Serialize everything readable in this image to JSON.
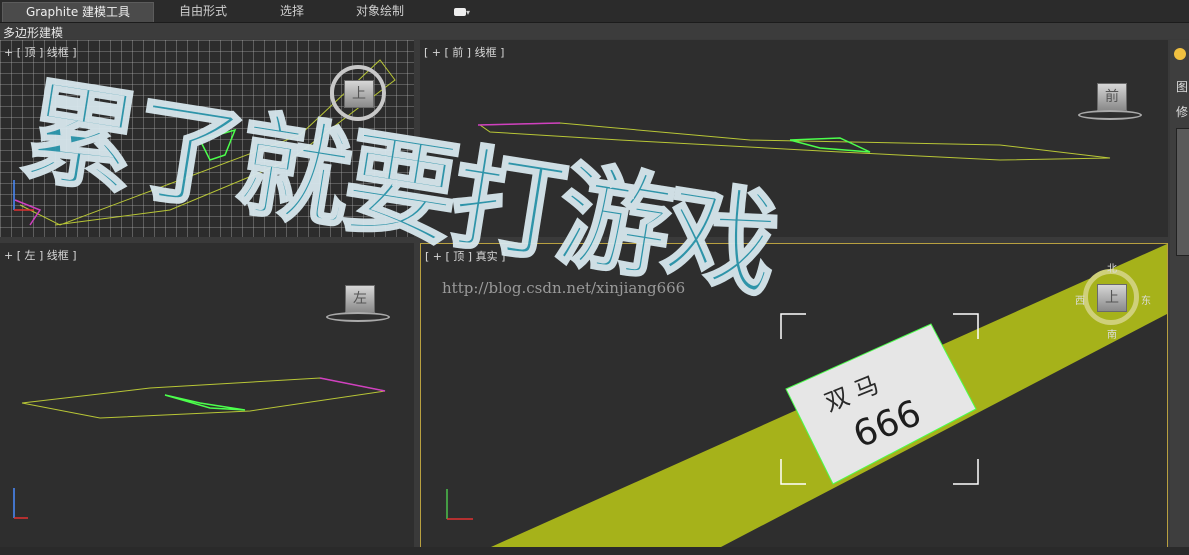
{
  "ribbon": {
    "tabs": [
      {
        "label": "Graphite 建模工具",
        "active": true
      },
      {
        "label": "自由形式"
      },
      {
        "label": "选择"
      },
      {
        "label": "对象绘制"
      }
    ]
  },
  "subbar": {
    "label": "多边形建模"
  },
  "viewports": {
    "top": {
      "label": "+ [ 顶 ] 线框 ]",
      "cube": "上"
    },
    "front": {
      "label": "[ + [ 前 ] 线框 ]",
      "cube": "前"
    },
    "left": {
      "label": "+ [ 左 ] 线框 ]",
      "cube": "左"
    },
    "persp": {
      "label": "[ + [ 顶 ] 真实 ]",
      "cube": "上"
    }
  },
  "compass": {
    "north": "北",
    "south": "南",
    "east": "东",
    "west": "西"
  },
  "plate_text": {
    "line1": "双 马",
    "line2": "666"
  },
  "watermark": {
    "text": "累了就要打游戏",
    "url": "http://blog.csdn.net/xinjiang666"
  },
  "side_panel": {
    "labels": [
      "图",
      "修"
    ]
  }
}
